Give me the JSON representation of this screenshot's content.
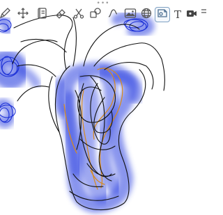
{
  "toolbar": {
    "grip": "•••",
    "tools": [
      {
        "id": "pen",
        "icon": "pen-icon"
      },
      {
        "id": "move",
        "icon": "move-arrows-icon"
      },
      {
        "id": "notebook",
        "icon": "notebook-icon"
      },
      {
        "id": "eraser",
        "icon": "eraser-icon"
      },
      {
        "id": "lasso-scissors",
        "icon": "scissors-icon"
      },
      {
        "id": "shapes",
        "icon": "shapes-icon"
      },
      {
        "id": "curve",
        "icon": "curve-icon"
      },
      {
        "id": "image",
        "icon": "image-icon"
      },
      {
        "id": "globe",
        "icon": "globe-icon"
      },
      {
        "id": "sticker",
        "icon": "sticker-icon",
        "selected": true
      },
      {
        "id": "text",
        "icon": "text-icon",
        "label": "T"
      },
      {
        "id": "camera",
        "icon": "camera-icon"
      },
      {
        "id": "more",
        "icon": "more-icon"
      }
    ]
  },
  "ink_colors": {
    "highlighter_blue": "#2a3fe0",
    "pen_black": "#111111",
    "pen_orange": "#d88a1a",
    "selected_tool_border": "#7d9fc2",
    "icon_color": "#555555"
  }
}
